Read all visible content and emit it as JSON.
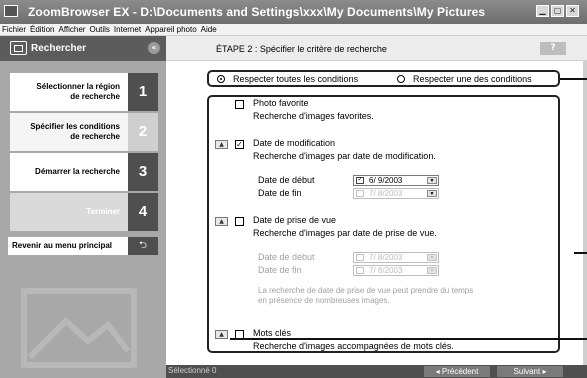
{
  "window": {
    "title": "ZoomBrowser EX  - D:\\Documents and Settings\\xxx\\My Documents\\My Pictures"
  },
  "menu": [
    "Fichier",
    "Édition",
    "Afficher",
    "Outils",
    "Internet",
    "Appareil photo",
    "Aide"
  ],
  "sidebar": {
    "header": "Rechercher",
    "steps": [
      {
        "label_line1": "Sélectionner la région",
        "label_line2": "de recherche",
        "num": "1"
      },
      {
        "label_line1": "Spécifier les conditions",
        "label_line2": "de recherche",
        "num": "2"
      },
      {
        "label_line1": "Démarrer la recherche",
        "num": "3"
      },
      {
        "label_line1": "Terminer",
        "num": "4"
      }
    ],
    "back_label": "Revenir au menu principal"
  },
  "page": {
    "step_title": "ÉTAPE 2 : Spécifier le critère de recherche",
    "help": "?"
  },
  "conditions": {
    "all": "Respecter toutes les conditions",
    "any": "Respecter une des conditions"
  },
  "criteria": {
    "favorite": {
      "title": "Photo favorite",
      "desc": "Recherche d'images favorites."
    },
    "modified": {
      "title": "Date de modification",
      "desc": "Recherche d'images par date de modification.",
      "start_label": "Date de début",
      "end_label": "Date de fin",
      "start_value": "6/ 9/2003",
      "end_value": "7/ 8/2003"
    },
    "shot": {
      "title": "Date de prise de vue",
      "desc": "Recherche d'images par date de prise de vue.",
      "start_label": "Date de début",
      "end_label": "Date de fin",
      "start_value": "7/ 8/2003",
      "end_value": "7/ 8/2003",
      "note1": "La recherche de date de prise de vue peut prendre du temps",
      "note2": "en présence de nombreuses images."
    },
    "keywords": {
      "title": "Mots clés",
      "desc": "Recherche d'images accompagnées de mots clés."
    }
  },
  "footer": {
    "selected": "Sélectionné 0",
    "prev": "◂ Précédent",
    "next": "Suivant ▸"
  }
}
